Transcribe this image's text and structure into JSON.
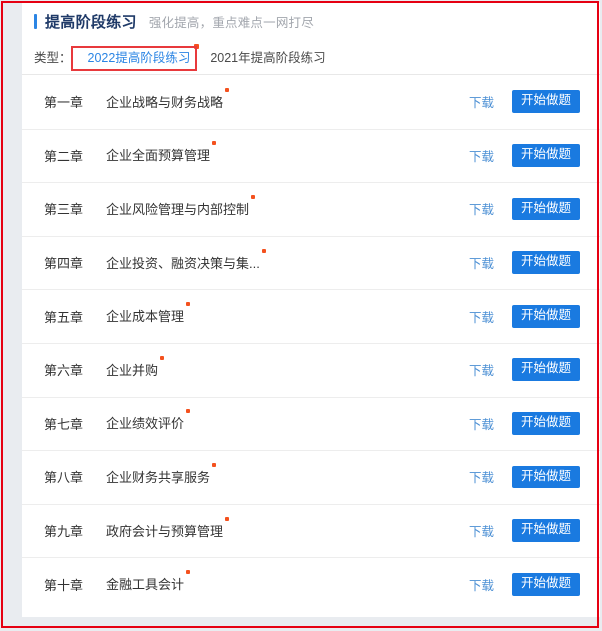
{
  "header": {
    "title": "提高阶段练习",
    "subtitle": "强化提高，重点难点一网打尽",
    "accent_color": "#2b85e4",
    "title_color": "#1f3a68",
    "subtitle_color": "#a2a6ad"
  },
  "tabs": {
    "label": "类型：",
    "items": [
      {
        "label": "2022提高阶段练习",
        "active": true,
        "has_badge": true
      },
      {
        "label": "2021年提高阶段练习",
        "active": false,
        "has_badge": false
      }
    ],
    "active_color": "#2b85e4",
    "inactive_color": "#4a4a4a",
    "badge_color": "#f4511e"
  },
  "annotations": {
    "outer_border_color": "#e60012",
    "tab_highlight_color": "#e8393c"
  },
  "list": {
    "download_label": "下载",
    "start_label": "开始做题",
    "link_color": "#4b8fd4",
    "button_color": "#1a7ae0",
    "new_dot_color": "#f4511e",
    "rows": [
      {
        "no": "第一章",
        "title": "企业战略与财务战略",
        "new": true
      },
      {
        "no": "第二章",
        "title": "企业全面预算管理",
        "new": true
      },
      {
        "no": "第三章",
        "title": "企业风险管理与内部控制",
        "new": true
      },
      {
        "no": "第四章",
        "title": "企业投资、融资决策与集...",
        "new": true
      },
      {
        "no": "第五章",
        "title": "企业成本管理",
        "new": true
      },
      {
        "no": "第六章",
        "title": "企业并购",
        "new": true
      },
      {
        "no": "第七章",
        "title": "企业绩效评价",
        "new": true
      },
      {
        "no": "第八章",
        "title": "企业财务共享服务",
        "new": true
      },
      {
        "no": "第九章",
        "title": "政府会计与预算管理",
        "new": true
      },
      {
        "no": "第十章",
        "title": "金融工具会计",
        "new": true
      }
    ]
  }
}
